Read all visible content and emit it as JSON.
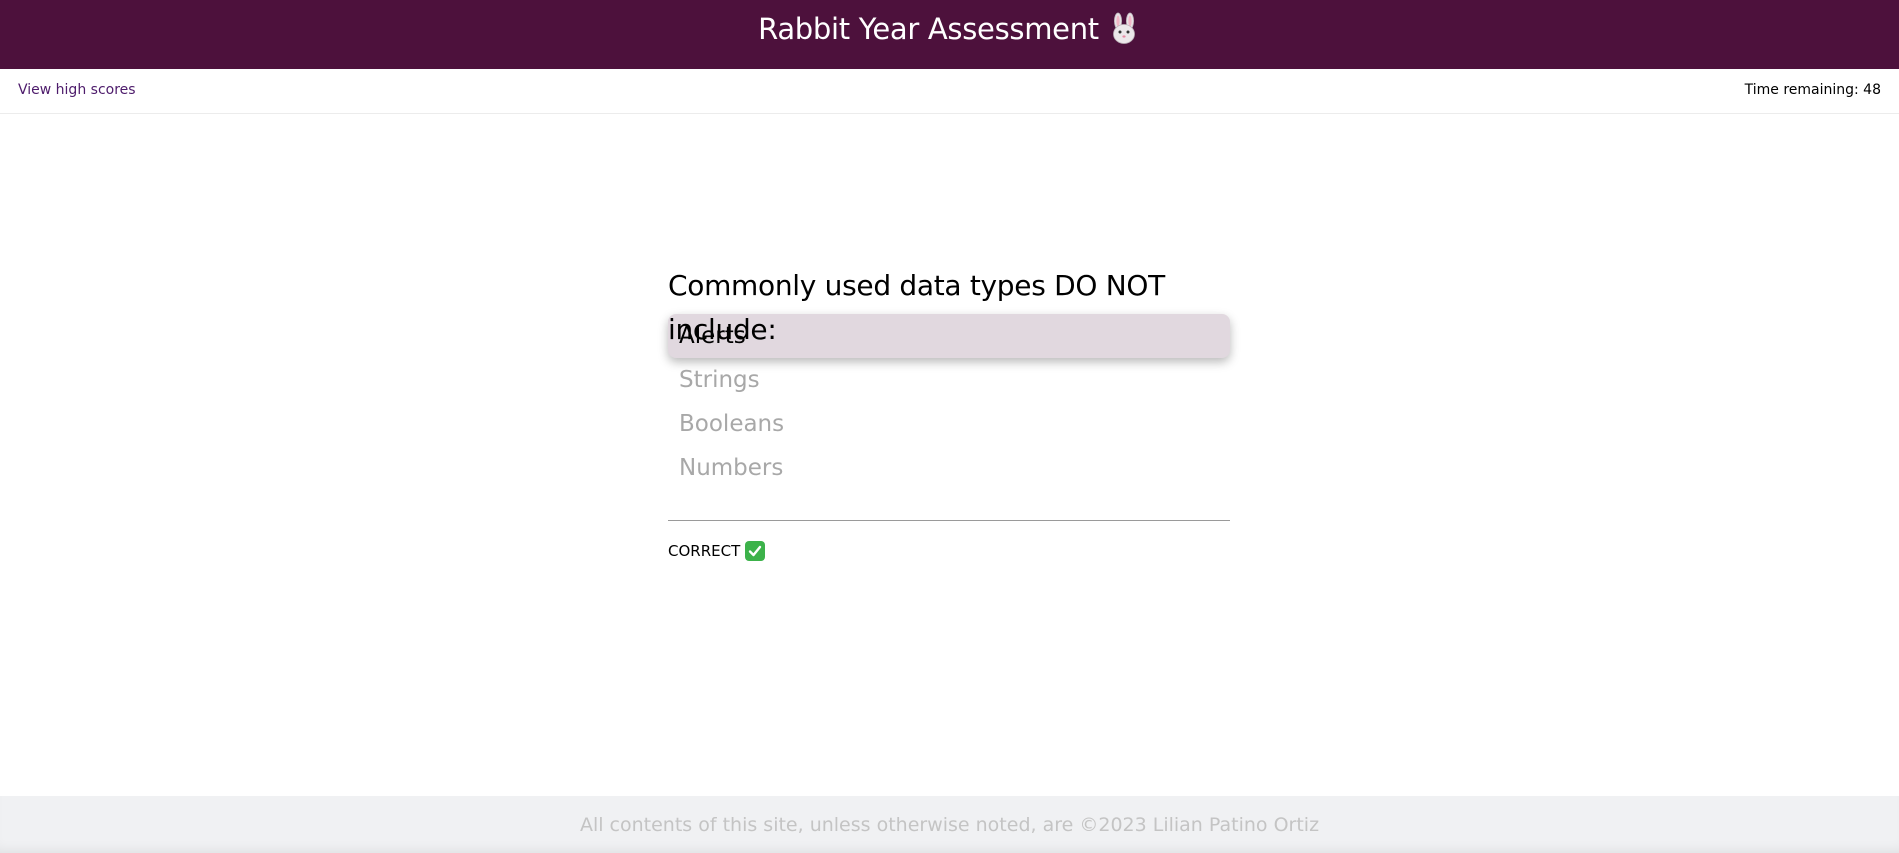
{
  "header": {
    "title": "Rabbit Year Assessment",
    "icon": "rabbit-face-icon",
    "background_color": "#4d113c"
  },
  "nav": {
    "high_scores_link": "View high scores",
    "timer_text": "Time remaining: 48"
  },
  "quiz": {
    "question": "Commonly used data types DO NOT include:",
    "answers": [
      {
        "label": "Alerts",
        "selected": true
      },
      {
        "label": "Strings",
        "selected": false
      },
      {
        "label": "Booleans",
        "selected": false
      },
      {
        "label": "Numbers",
        "selected": false
      }
    ],
    "selected_color": "#e1d8df",
    "feedback_text": "CORRECT",
    "feedback_icon": "check-mark-icon"
  },
  "footer": {
    "text": "All contents of this site, unless otherwise noted, are ©2023 Lilian Patino Ortiz"
  }
}
